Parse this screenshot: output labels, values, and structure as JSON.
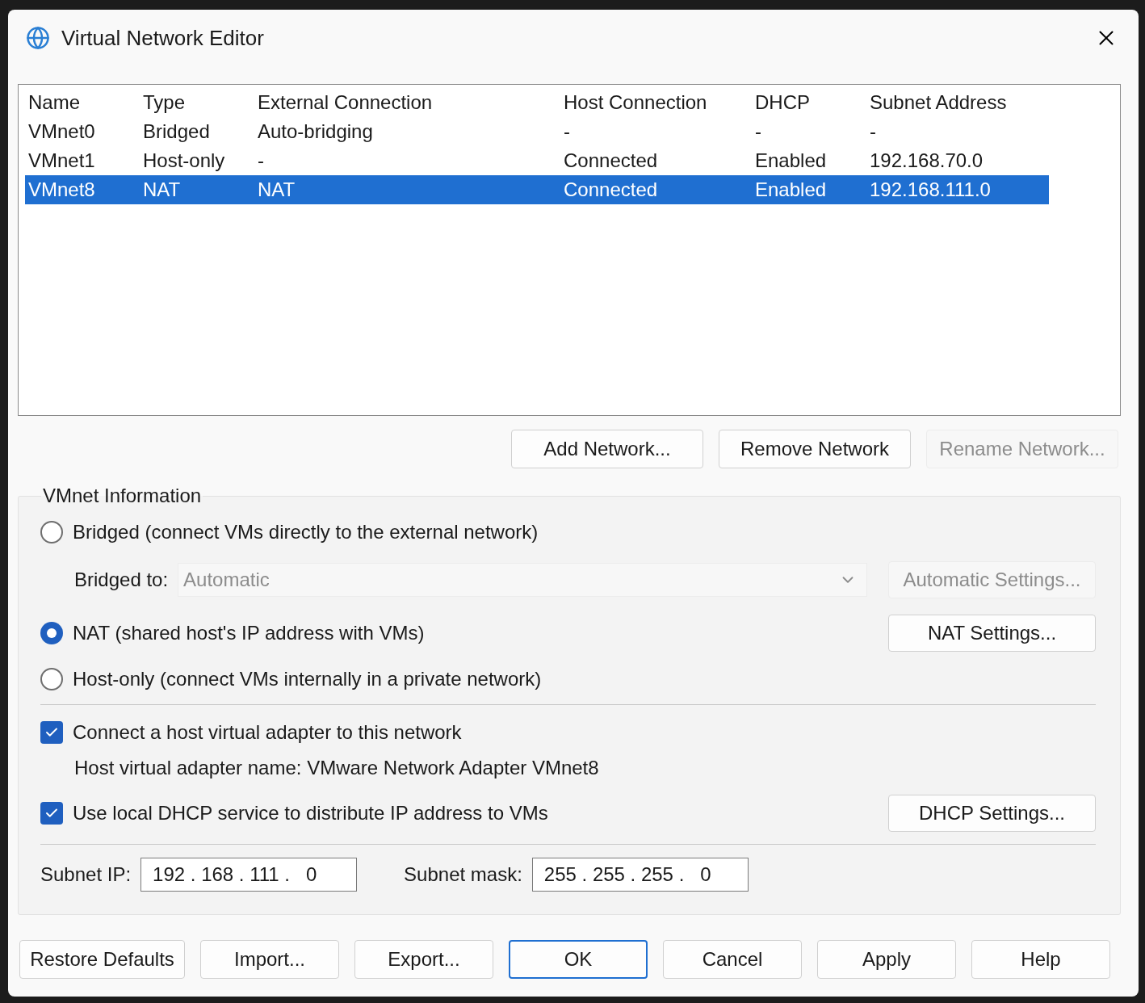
{
  "window": {
    "title": "Virtual Network Editor"
  },
  "table": {
    "columns": [
      "Name",
      "Type",
      "External Connection",
      "Host Connection",
      "DHCP",
      "Subnet Address"
    ],
    "rows": [
      {
        "cells": [
          "VMnet0",
          "Bridged",
          "Auto-bridging",
          "-",
          "-",
          "-"
        ],
        "selected": false
      },
      {
        "cells": [
          "VMnet1",
          "Host-only",
          "-",
          "Connected",
          "Enabled",
          "192.168.70.0"
        ],
        "selected": false
      },
      {
        "cells": [
          "VMnet8",
          "NAT",
          "NAT",
          "Connected",
          "Enabled",
          "192.168.111.0"
        ],
        "selected": true
      }
    ]
  },
  "network_buttons": [
    {
      "label": "Add Network...",
      "disabled": false
    },
    {
      "label": "Remove Network",
      "disabled": false
    },
    {
      "label": "Rename Network...",
      "disabled": true
    }
  ],
  "vmnet_information": {
    "title": "VMnet Information",
    "connection_types": [
      {
        "label": "Bridged (connect VMs directly to the external network)",
        "selected": false,
        "bridged_to": {
          "label": "Bridged to:",
          "value": "Automatic",
          "disabled": true,
          "button": {
            "label": "Automatic Settings...",
            "disabled": true
          }
        }
      },
      {
        "label": "NAT (shared host's IP address with VMs)",
        "selected": true,
        "button": {
          "label": "NAT Settings...",
          "disabled": false
        }
      },
      {
        "label": "Host-only (connect VMs internally in a private network)",
        "selected": false
      }
    ],
    "options": [
      {
        "label": "Connect a host virtual adapter to this network",
        "checked": true,
        "note": "Host virtual adapter name: VMware Network Adapter VMnet8"
      },
      {
        "label": "Use local DHCP service to distribute IP address to VMs",
        "checked": true,
        "button": {
          "label": "DHCP Settings...",
          "disabled": false
        }
      }
    ],
    "subnet_ip": {
      "label": "Subnet IP:",
      "value": "192 . 168 . 111 .   0"
    },
    "subnet_mask": {
      "label": "Subnet mask:",
      "value": "255 . 255 . 255 .   0"
    }
  },
  "footer_buttons": [
    {
      "label": "Restore Defaults",
      "default": false
    },
    {
      "label": "Import...",
      "default": false
    },
    {
      "label": "Export...",
      "default": false
    },
    {
      "label": "OK",
      "default": true
    },
    {
      "label": "Cancel",
      "default": false
    },
    {
      "label": "Apply",
      "default": false
    },
    {
      "label": "Help",
      "default": false
    }
  ]
}
